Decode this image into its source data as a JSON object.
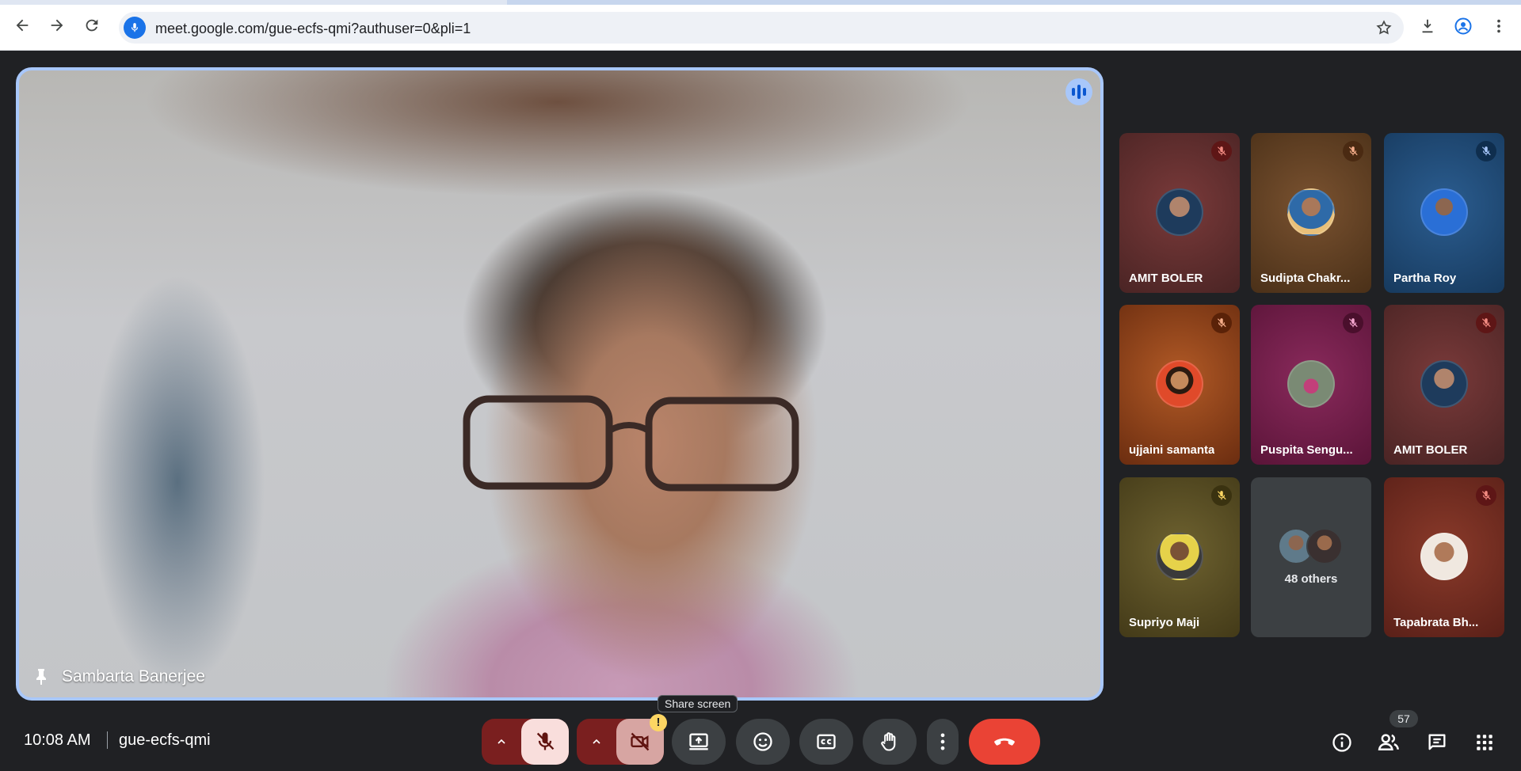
{
  "browser": {
    "url": "meet.google.com/gue-ecfs-qmi?authuser=0&pli=1"
  },
  "main_video": {
    "presenter_name": "Sambarta Banerjee"
  },
  "tiles": [
    {
      "name": "AMIT BOLER",
      "bg": "#6e2f2f"
    },
    {
      "name": "Sudipta Chakr...",
      "bg": "#6b4423"
    },
    {
      "name": "Partha Roy",
      "bg": "#1f4a75"
    },
    {
      "name": "ujjaini samanta",
      "bg": "#8a3b14"
    },
    {
      "name": "Puspita Sengu...",
      "bg": "#7a1f4e"
    },
    {
      "name": "AMIT BOLER",
      "bg": "#6e2f2f"
    },
    {
      "name": "Supriyo Maji",
      "bg": "#5a4e22"
    },
    {
      "name": "48 others",
      "bg": "#3c4043"
    },
    {
      "name": "Tapabrata Bh...",
      "bg": "#7a3024"
    }
  ],
  "bottom_bar": {
    "time": "10:08 AM",
    "meeting_code": "gue-ecfs-qmi",
    "tooltip": "Share screen",
    "participant_count": "57"
  },
  "colors": {
    "leave": "#ea4335",
    "active_border": "#a8c7fa",
    "muted_control": "#f9dedc"
  }
}
